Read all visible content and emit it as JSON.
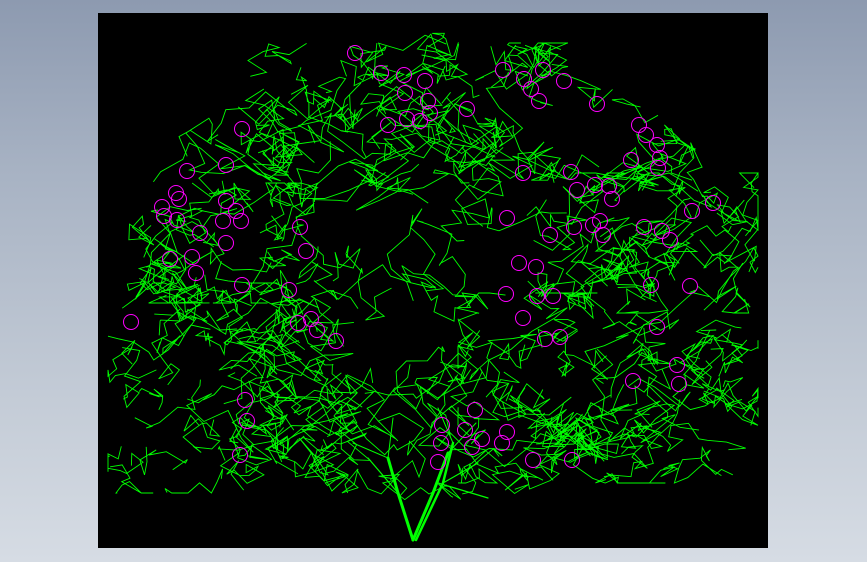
{
  "canvas": {
    "background": "#000000",
    "frame_background": "#a9b4c4"
  },
  "drawing": {
    "subject": "tree-elevation",
    "foliage_color": "#00ff00",
    "trunk_color": "#00ff00",
    "fruit_color": "#ff00ff"
  }
}
